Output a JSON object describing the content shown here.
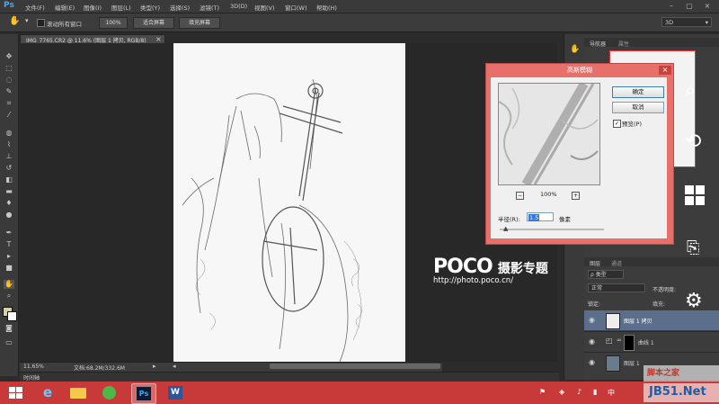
{
  "app": {
    "logo": "Ps"
  },
  "menu": [
    "文件(F)",
    "编辑(E)",
    "图像(I)",
    "图层(L)",
    "类型(Y)",
    "选择(S)",
    "滤镜(T)",
    "3D(D)",
    "视图(V)",
    "窗口(W)",
    "帮助(H)"
  ],
  "workspace": "3D",
  "options": {
    "scroll_all_label": "滚动所有窗口",
    "zoom_btn": "100%",
    "fit_btn": "适合屏幕",
    "fill_btn": "填充屏幕"
  },
  "document": {
    "tab_title": "IMG_7765.CR2 @ 11.6% (图层 1 拷贝, RGB/8)",
    "tab_close": "×",
    "zoom": "11.65%",
    "doc_size": "文档:68.2M/332.6M"
  },
  "watermark": {
    "brand": "POCO",
    "brand_cn": "摄影专题",
    "url": "http://photo.poco.cn/"
  },
  "timeline_tab": "时间轴",
  "panels": {
    "navigator_tab": "导航器",
    "histogram_tab": "属性",
    "layers_tab": "图层",
    "channels_tab": "通道",
    "kind_label": "ρ 类型",
    "blend_mode": "正常",
    "opacity_label": "不透明度:",
    "lock_label": "锁定:",
    "fill_label": "填充:",
    "layers": [
      {
        "name": "图层 1 拷贝",
        "selected": true
      },
      {
        "name": "曲线 1",
        "selected": false
      },
      {
        "name": "图层 1",
        "selected": false
      }
    ]
  },
  "dialog": {
    "title": "高斯模糊",
    "close": "×",
    "ok": "确定",
    "cancel": "取消",
    "preview_label": "预览(P)",
    "preview_checked": true,
    "zoom_pct": "100%",
    "radius_label": "半径(R):",
    "radius_value": "1.5",
    "radius_unit": "像素",
    "accent": "#e8706b"
  },
  "site_watermark": {
    "line1": "脚本之家",
    "line2": "JB51.Net"
  },
  "taskbar": {
    "apps": [
      "windows-start",
      "internet-explorer",
      "file-explorer",
      "app-green",
      "photoshop",
      "word"
    ]
  }
}
